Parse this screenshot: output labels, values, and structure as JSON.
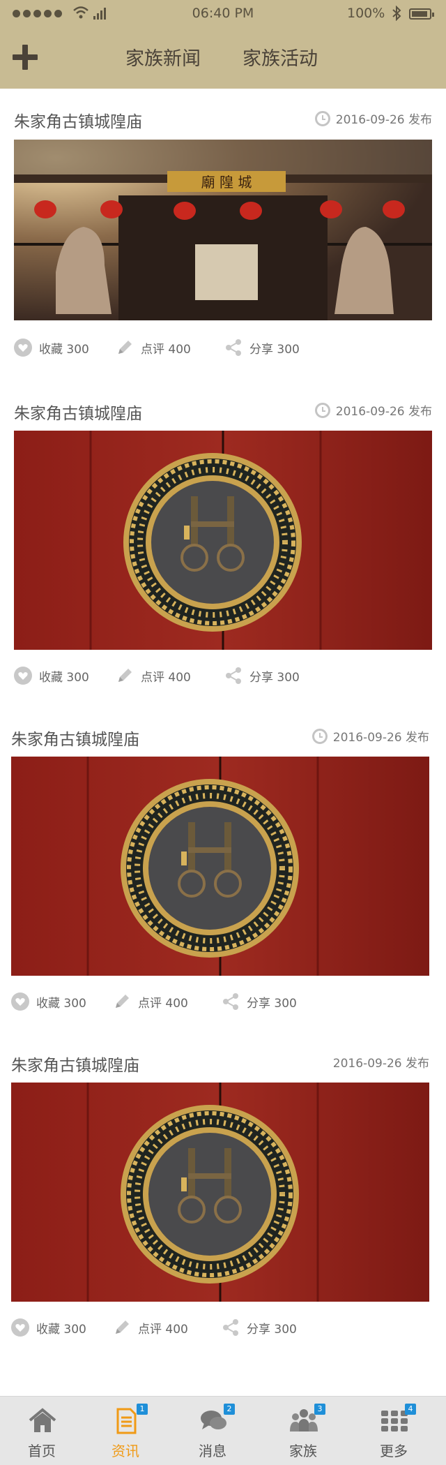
{
  "status_bar": {
    "time": "06:40 PM",
    "battery_percent": "100%"
  },
  "header": {
    "tabs": [
      {
        "label": "家族新闻"
      },
      {
        "label": "家族活动"
      }
    ]
  },
  "articles": [
    {
      "title": "朱家角古镇城隍庙",
      "date": "2016-09-26 发布",
      "image": "temple-gate-photo",
      "favorite": "收藏 300",
      "comment": "点评 400",
      "share": "分享 300"
    },
    {
      "title": "朱家角古镇城隍庙",
      "date": "2016-09-26 发布",
      "image": "red-door-photo",
      "favorite": "收藏 300",
      "comment": "点评 400",
      "share": "分享 300"
    },
    {
      "title": "朱家角古镇城隍庙",
      "date": "2016-09-26 发布",
      "image": "red-door-photo",
      "favorite": "收藏 300",
      "comment": "点评 400",
      "share": "分享 300"
    },
    {
      "title": "朱家角古镇城隍庙",
      "date": "2016-09-26 发布",
      "image": "red-door-photo",
      "favorite": "收藏 300",
      "comment": "点评 400",
      "share": "分享 300"
    }
  ],
  "bottom_nav": [
    {
      "label": "首页",
      "icon": "home-icon",
      "badge": ""
    },
    {
      "label": "资讯",
      "icon": "document-icon",
      "badge": "1",
      "active": true
    },
    {
      "label": "消息",
      "icon": "chat-icon",
      "badge": "2"
    },
    {
      "label": "家族",
      "icon": "family-icon",
      "badge": "3"
    },
    {
      "label": "更多",
      "icon": "grid-icon",
      "badge": "4"
    }
  ],
  "colors": {
    "header_bg": "#c8bb93",
    "active_tab": "#f09a16",
    "badge": "#1f8fd8"
  }
}
